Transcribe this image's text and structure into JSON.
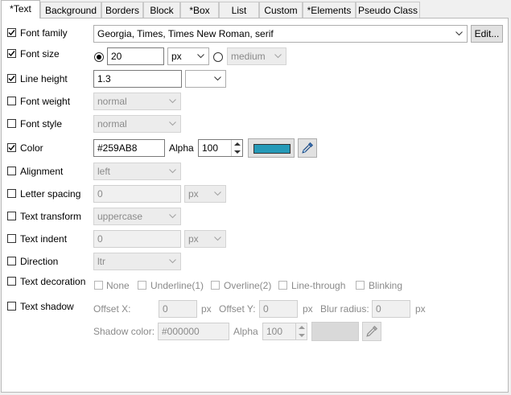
{
  "tabs": [
    "*Text",
    "Background",
    "Borders",
    "Block",
    "*Box",
    "List",
    "Custom",
    "*Elements",
    "Pseudo Class"
  ],
  "rows": {
    "font_family": {
      "label": "Font family",
      "checked": true,
      "value": "Georgia, Times, Times New Roman, serif",
      "edit_label": "Edit..."
    },
    "font_size": {
      "label": "Font size",
      "checked": true,
      "value": "20",
      "unit": "px",
      "named_value": "medium",
      "selected_option": "value"
    },
    "line_height": {
      "label": "Line height",
      "checked": true,
      "value": "1.3",
      "unit": ""
    },
    "font_weight": {
      "label": "Font weight",
      "checked": false,
      "value": "normal"
    },
    "font_style": {
      "label": "Font style",
      "checked": false,
      "value": "normal"
    },
    "color": {
      "label": "Color",
      "checked": true,
      "value": "#259AB8",
      "alpha_label": "Alpha",
      "alpha": "100",
      "swatch": "#259ab8",
      "picker_icon": "eyedropper-icon"
    },
    "alignment": {
      "label": "Alignment",
      "checked": false,
      "value": "left"
    },
    "letter_spacing": {
      "label": "Letter spacing",
      "checked": false,
      "value": "0",
      "unit": "px"
    },
    "text_transform": {
      "label": "Text transform",
      "checked": false,
      "value": "uppercase"
    },
    "text_indent": {
      "label": "Text indent",
      "checked": false,
      "value": "0",
      "unit": "px"
    },
    "direction": {
      "label": "Direction",
      "checked": false,
      "value": "ltr"
    },
    "text_decoration": {
      "label": "Text decoration",
      "checked": false,
      "options": [
        "None",
        "Underline(1)",
        "Overline(2)",
        "Line-through",
        "Blinking"
      ]
    },
    "text_shadow": {
      "label": "Text shadow",
      "checked": false,
      "offset_x_label": "Offset X:",
      "offset_x": "0",
      "offset_x_unit": "px",
      "offset_y_label": "Offset Y:",
      "offset_y": "0",
      "offset_y_unit": "px",
      "blur_label": "Blur radius:",
      "blur": "0",
      "blur_unit": "px",
      "shadow_color_label": "Shadow color:",
      "shadow_color": "#000000",
      "alpha_label": "Alpha",
      "alpha": "100",
      "picker_icon": "eyedropper-icon"
    }
  }
}
